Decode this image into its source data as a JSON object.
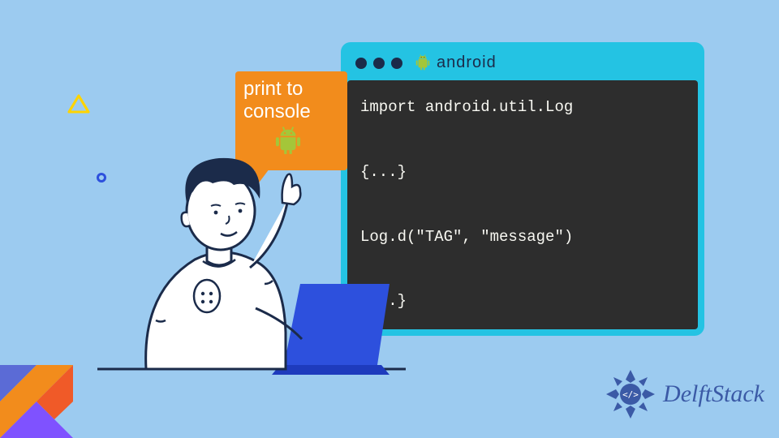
{
  "speech": {
    "line1": "print to",
    "line2": "console"
  },
  "window": {
    "platform_label": "android"
  },
  "code": {
    "line1": "import android.util.Log",
    "line2": "{...}",
    "line3": "Log.d(\"TAG\", \"message\")",
    "line4": "{...}"
  },
  "branding": {
    "site_name": "DelftStack"
  },
  "colors": {
    "background": "#9ccbf0",
    "window_frame": "#24c3e3",
    "code_bg": "#2d2d2d",
    "bubble": "#f28c1c",
    "android_green": "#a4c639",
    "kotlin_orange": "#f28c1c",
    "kotlin_purple": "#7f52ff",
    "delftstack_blue": "#3b5aa6"
  }
}
